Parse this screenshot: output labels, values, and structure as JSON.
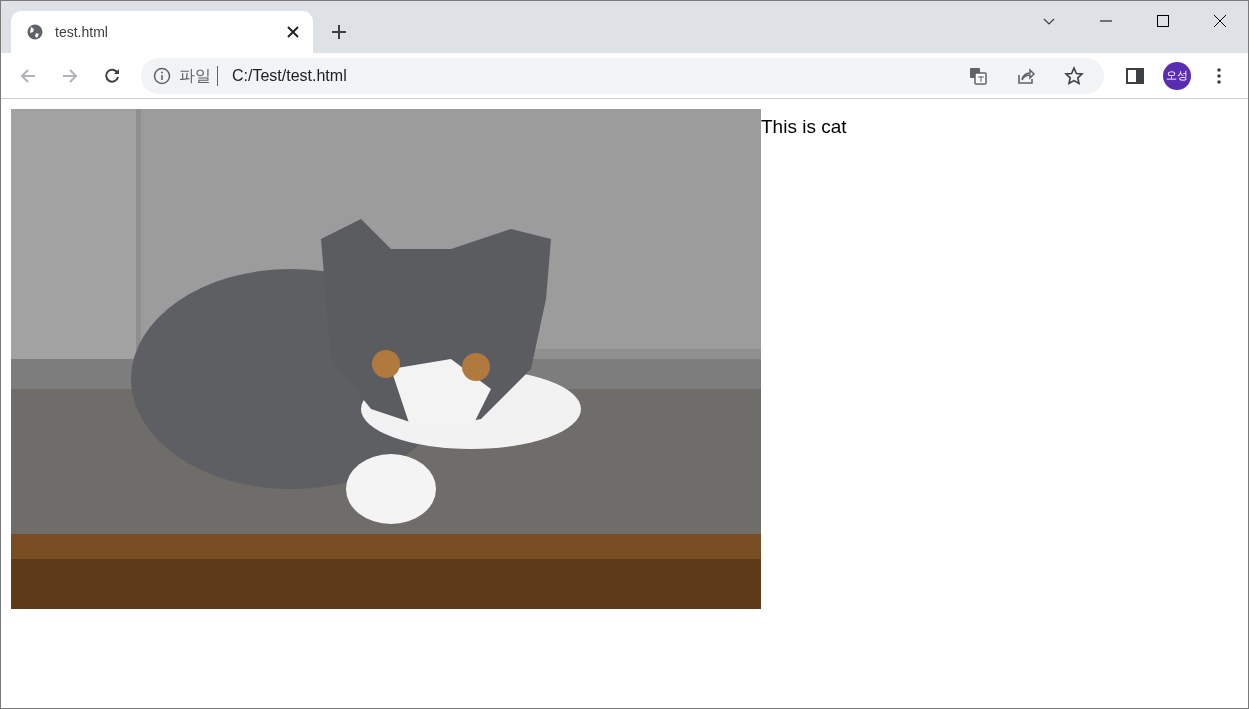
{
  "browser": {
    "tabs": [
      {
        "title": "test.html",
        "selected": true
      }
    ],
    "address_bar": {
      "scheme_label": "파일",
      "url": "C:/Test/test.html"
    },
    "profile": {
      "initials": "오성",
      "color": "#5a2db0"
    }
  },
  "page": {
    "caption": "This is cat"
  }
}
